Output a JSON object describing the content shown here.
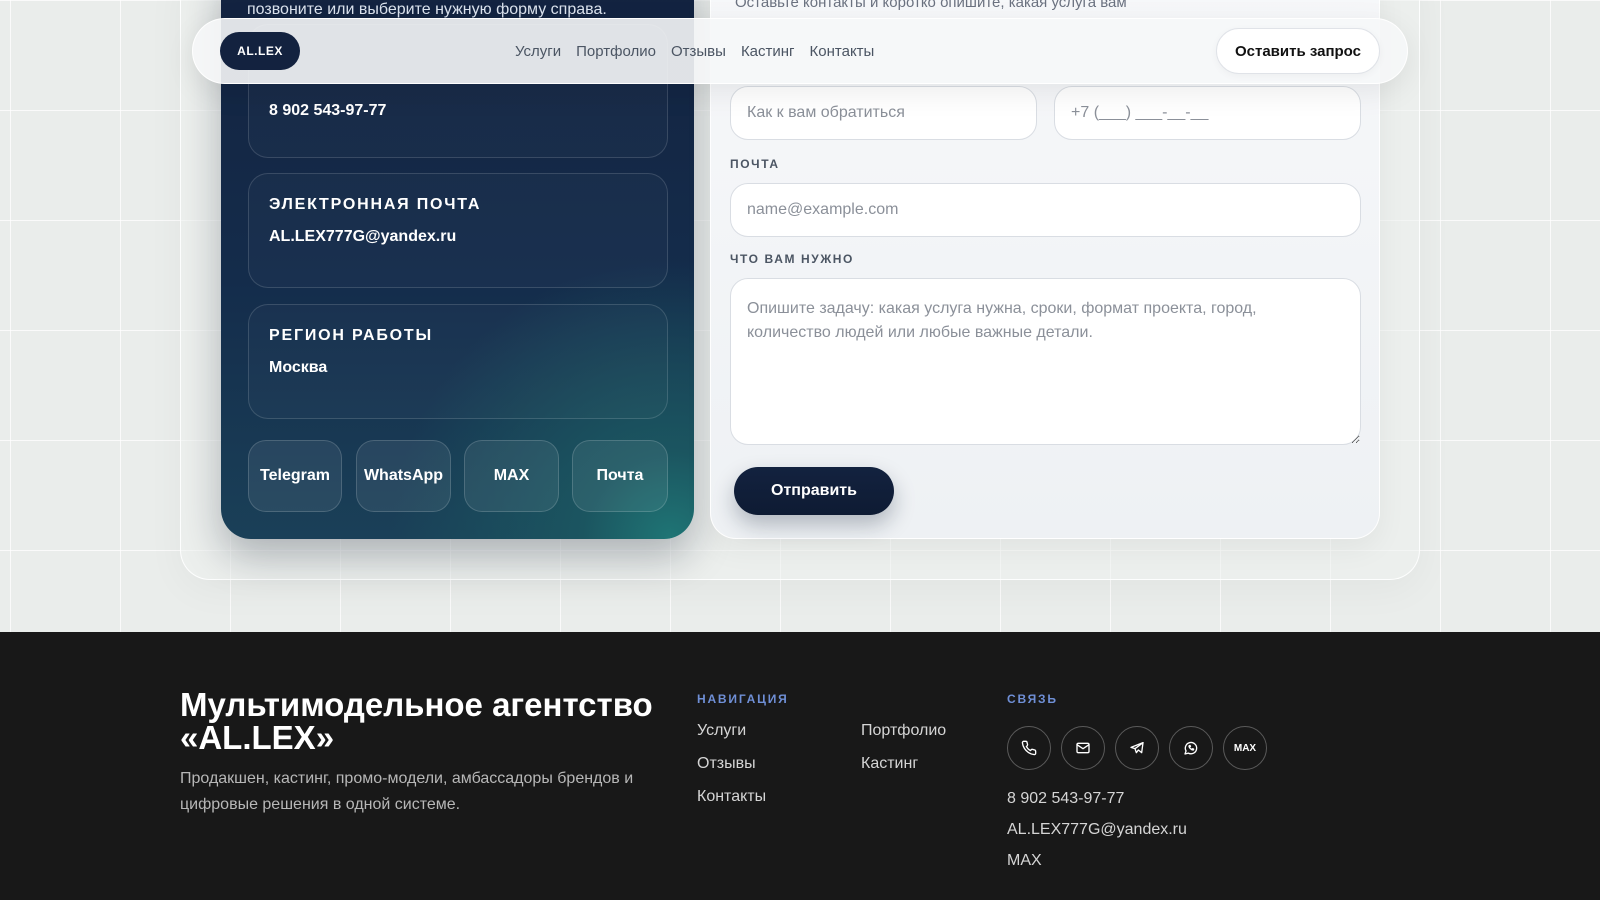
{
  "navbar": {
    "logo": "AL.LEX",
    "links": [
      "Услуги",
      "Портфолио",
      "Отзывы",
      "Кастинг",
      "Контакты"
    ],
    "cta_label": "Оставить запрос"
  },
  "contact_card": {
    "intro_text": "позвоните или выберите нужную форму справа.",
    "phone_value": "8 902 543-97-77",
    "email_label": "ЭЛЕКТРОННАЯ ПОЧТА",
    "email_value": "AL.LEX777G@yandex.ru",
    "region_label": "РЕГИОН РАБОТЫ",
    "region_value": "Москва",
    "social_buttons": [
      "Telegram",
      "WhatsApp",
      "MAX",
      "Почта"
    ]
  },
  "form": {
    "intro_text": "Оставьте контакты и коротко опишите, какая услуга вам",
    "name_placeholder": "Как к вам обратиться",
    "phone_placeholder": "+7 (___) ___-__-__",
    "email_label": "ПОЧТА",
    "email_placeholder": "name@example.com",
    "need_label": "ЧТО ВАМ НУЖНО",
    "need_placeholder": "Опишите задачу: какая услуга нужна, сроки, формат проекта, город, количество людей или любые важные детали.",
    "submit_label": "Отправить"
  },
  "footer": {
    "title": "Мультимодельное агентство «AL.LEX»",
    "description": "Продакшен, кастинг, промо-модели, амбассадоры брендов и цифровые решения в одной системе.",
    "nav_heading": "НАВИГАЦИЯ",
    "nav_links": [
      "Услуги",
      "Портфолио",
      "Отзывы",
      "Кастинг",
      "Контакты"
    ],
    "contact_heading": "СВЯЗЬ",
    "contact_icons": [
      "phone-icon",
      "mail-icon",
      "telegram-icon",
      "whatsapp-icon",
      "max-icon"
    ],
    "max_icon_text": "MAX",
    "phone": "8 902 543-97-77",
    "email": "AL.LEX777G@yandex.ru",
    "max": "MAX"
  },
  "colors": {
    "navy": "#13223f",
    "teal_glow": "#1f7575",
    "footer_bg": "#181818",
    "footer_heading": "#6f8fd6"
  }
}
